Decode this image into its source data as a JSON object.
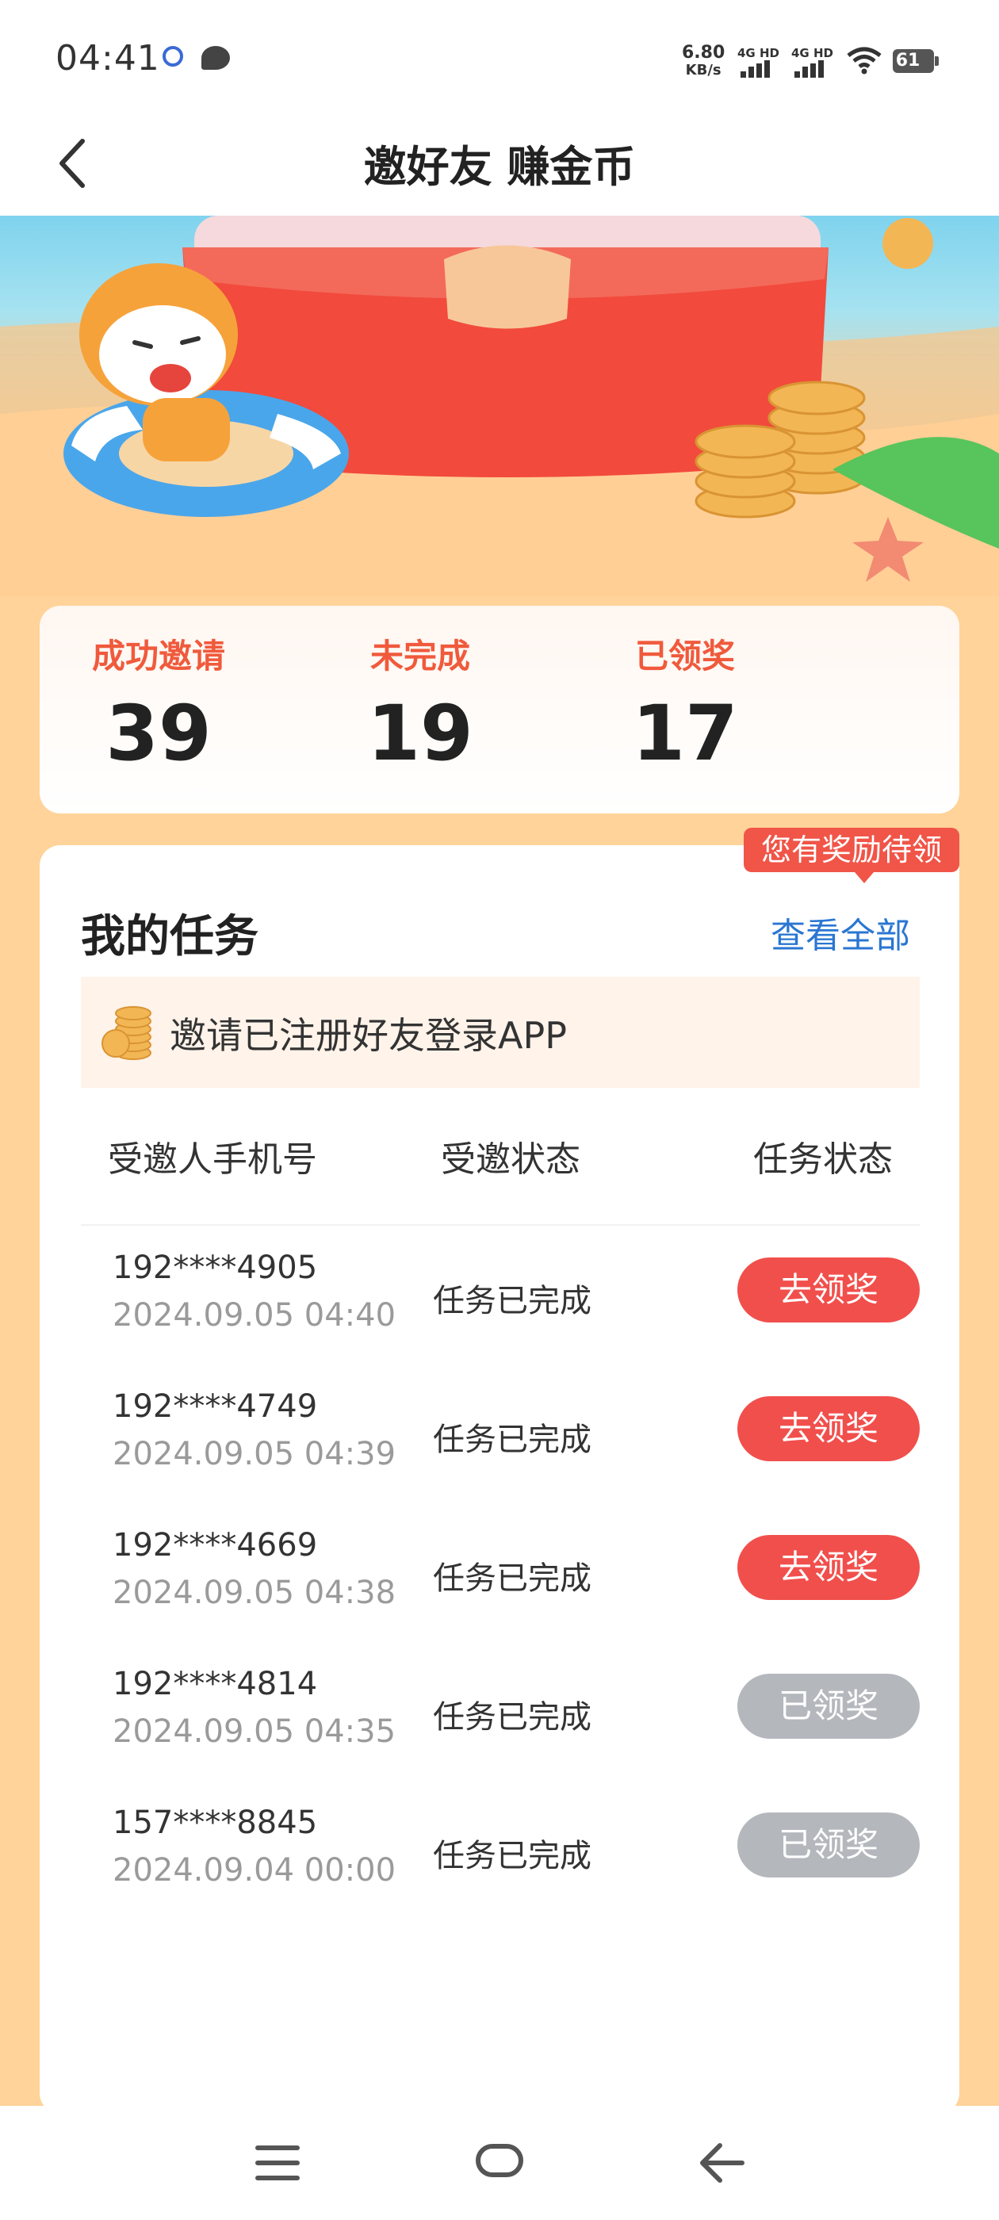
{
  "status_bar": {
    "time": "04:41",
    "net_speed": "6.80",
    "net_unit": "KB/s",
    "sig1": "4G HD",
    "sig2": "4G HD",
    "battery": "61"
  },
  "header": {
    "title": "邀好友 赚金币"
  },
  "stats": [
    {
      "label": "成功邀请",
      "value": "39"
    },
    {
      "label": "未完成",
      "value": "19"
    },
    {
      "label": "已领奖",
      "value": "17"
    }
  ],
  "tasks": {
    "reward_tag": "您有奖励待领",
    "title": "我的任务",
    "view_all": "查看全部",
    "task_text": "邀请已注册好友登录APP",
    "columns": [
      "受邀人手机号",
      "受邀状态",
      "任务状态"
    ],
    "rows": [
      {
        "phone": "192****4905",
        "time": "2024.09.05 04:40",
        "status": "任务已完成",
        "action": "去领奖",
        "action_state": "claim"
      },
      {
        "phone": "192****4749",
        "time": "2024.09.05 04:39",
        "status": "任务已完成",
        "action": "去领奖",
        "action_state": "claim"
      },
      {
        "phone": "192****4669",
        "time": "2024.09.05 04:38",
        "status": "任务已完成",
        "action": "去领奖",
        "action_state": "claim"
      },
      {
        "phone": "192****4814",
        "time": "2024.09.05 04:35",
        "status": "任务已完成",
        "action": "已领奖",
        "action_state": "claimed"
      },
      {
        "phone": "157****8845",
        "time": "2024.09.04 00:00",
        "status": "任务已完成",
        "action": "已领奖",
        "action_state": "claimed"
      }
    ]
  },
  "colors": {
    "accent_red": "#f14f4c",
    "stat_label": "#f05a3c",
    "link_blue": "#2a76d2",
    "page_bg": "#ffd399",
    "claimed_gray": "#b4b7bc"
  },
  "icons": {
    "back": "chevron-left-icon",
    "nav_menu": "menu-icon",
    "nav_home": "home-icon",
    "nav_back": "back-arrow-icon",
    "coins": "coin-stack-icon"
  }
}
